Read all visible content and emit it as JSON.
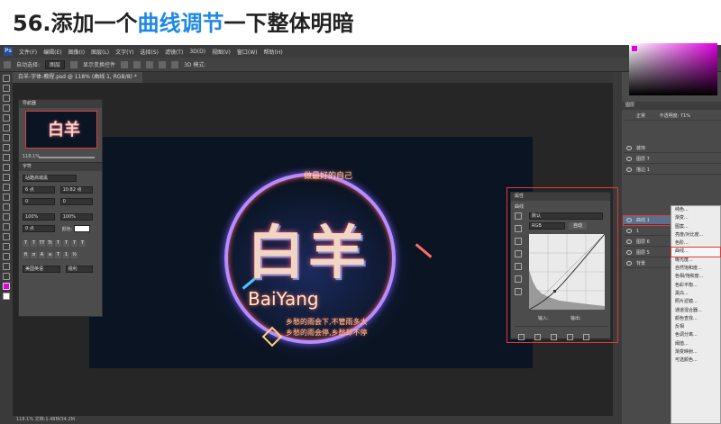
{
  "title": {
    "prefix": "56.添加一个",
    "highlight": "曲线调节",
    "suffix": "一下整体明暗"
  },
  "colors": {
    "title_highlight": "#1e88e5",
    "annotation": "#e03a3a",
    "foreground_color": "#e000e0"
  },
  "photoshop": {
    "menu": [
      "文件(F)",
      "编辑(E)",
      "图像(I)",
      "图层(L)",
      "文字(Y)",
      "选择(S)",
      "滤镜(T)",
      "3D(D)",
      "视图(V)",
      "窗口(W)",
      "帮助(H)"
    ],
    "options": {
      "auto_select": "自动选择:",
      "auto_select_target": "图层",
      "show_transform": "显示变换控件",
      "mode_3d": "3D 模式:"
    },
    "document_tab": "白羊-字体-教程.psd @ 118% (曲线 1, RGB/8) *",
    "status": "118.1%   文档:1.48M/34.2M",
    "navigator": {
      "title": "导航器",
      "thumb_text": "白羊",
      "zoom": "118.1%"
    },
    "character": {
      "title": "字符",
      "font_family": "站酷高端黑",
      "font_size": "6 点",
      "leading": "10.82 点",
      "kerning": "0",
      "tracking": "0",
      "vscale": "100%",
      "hscale": "100%",
      "baseline": "0 点",
      "color_label": "颜色:",
      "language": "美国英语",
      "aa": "锐利"
    },
    "artwork": {
      "main_chars": "白羊",
      "latin": "BaiYang",
      "small": "做最好的自己",
      "tag1": "乡愁的雨会下,不管雨多大",
      "tag2": "乡愁的雨会停,乡愁却不停"
    },
    "curves_panel": {
      "title": "属性",
      "header": "曲线",
      "preset": "默认",
      "channel": "RGB",
      "auto": "自动",
      "input_label": "输入:",
      "output_label": "输出:"
    },
    "layers_panel": {
      "title": "图层",
      "mode": "正常",
      "opacity": "不透明度: 71%",
      "layers": [
        {
          "name": "装饰"
        },
        {
          "name": "图层 7"
        },
        {
          "name": "描边 1"
        },
        {
          "name": "曲线 1",
          "selected": true
        },
        {
          "name": "1"
        },
        {
          "name": "图层 6"
        },
        {
          "name": "图层 5"
        },
        {
          "name": "背景"
        }
      ]
    },
    "adjustment_menu": [
      "纯色...",
      "渐变...",
      "图案...",
      "亮度/对比度...",
      "色阶...",
      "曲线...",
      "曝光度...",
      "自然饱和度...",
      "色相/饱和度...",
      "色彩平衡...",
      "黑白...",
      "照片滤镜...",
      "通道混合器...",
      "颜色查找...",
      "反相",
      "色调分离...",
      "阈值...",
      "渐变映射...",
      "可选颜色..."
    ],
    "highlighted_menu_item": "曲线..."
  }
}
